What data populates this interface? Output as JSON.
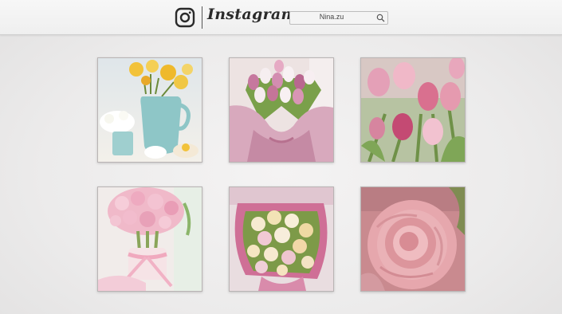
{
  "header": {
    "brand": "Instagram",
    "logo_icon": "instagram-camera-icon",
    "search": {
      "value": "Nina.zu",
      "icon": "search-icon"
    }
  },
  "feed": {
    "photos": [
      {
        "subject": "photo-daffodils-blue-pitcher"
      },
      {
        "subject": "photo-tulip-bouquet-pink-wrap"
      },
      {
        "subject": "photo-pink-tulips"
      },
      {
        "subject": "photo-pink-hyacinths"
      },
      {
        "subject": "photo-alstroemeria-bouquet"
      },
      {
        "subject": "photo-pink-rose"
      }
    ]
  },
  "colors": {
    "background": "#ececec",
    "header": "#f2f2f2",
    "text": "#2a2a2a"
  }
}
